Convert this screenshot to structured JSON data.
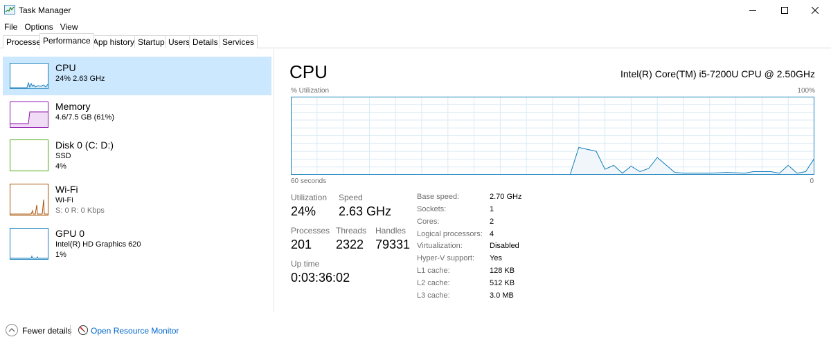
{
  "window": {
    "title": "Task Manager",
    "icon": "task-manager-icon"
  },
  "menu": [
    "File",
    "Options",
    "View"
  ],
  "tabs": [
    "Processes",
    "Performance",
    "App history",
    "Startup",
    "Users",
    "Details",
    "Services"
  ],
  "active_tab": "Performance",
  "resources": [
    {
      "name": "CPU",
      "line1": "24% 2.63 GHz",
      "line2": "",
      "color": "#117dbb",
      "selected": true
    },
    {
      "name": "Memory",
      "line1": "4.6/7.5 GB (61%)",
      "line2": "",
      "color": "#8b12ae",
      "selected": false
    },
    {
      "name": "Disk 0 (C: D:)",
      "line1": "SSD",
      "line2": "4%",
      "color": "#4da60c",
      "selected": false
    },
    {
      "name": "Wi-Fi",
      "line1": "Wi-Fi",
      "line2": "S: 0 R: 0 Kbps",
      "color": "#a74f01",
      "selected": false
    },
    {
      "name": "GPU 0",
      "line1": "Intel(R) HD Graphics 620",
      "line2": "1%",
      "color": "#117dbb",
      "selected": false
    }
  ],
  "detail": {
    "title": "CPU",
    "model": "Intel(R) Core(TM) i5-7200U CPU @ 2.50GHz",
    "util_label": "% Utilization",
    "util_max": "100%",
    "time_left": "60 seconds",
    "time_right": "0",
    "graph_color": "#117dbb",
    "stats": {
      "utilization_label": "Utilization",
      "utilization": "24%",
      "speed_label": "Speed",
      "speed": "2.63 GHz",
      "processes_label": "Processes",
      "processes": "201",
      "threads_label": "Threads",
      "threads": "2322",
      "handles_label": "Handles",
      "handles": "79331",
      "uptime_label": "Up time",
      "uptime": "0:03:36:02"
    },
    "specs": [
      {
        "label": "Base speed:",
        "value": "2.70 GHz"
      },
      {
        "label": "Sockets:",
        "value": "1"
      },
      {
        "label": "Cores:",
        "value": "2"
      },
      {
        "label": "Logical processors:",
        "value": "4"
      },
      {
        "label": "Virtualization:",
        "value": "Disabled"
      },
      {
        "label": "Hyper-V support:",
        "value": "Yes"
      },
      {
        "label": "L1 cache:",
        "value": "128 KB"
      },
      {
        "label": "L2 cache:",
        "value": "512 KB"
      },
      {
        "label": "L3 cache:",
        "value": "3.0 MB"
      }
    ]
  },
  "footer": {
    "fewer_details": "Fewer details",
    "open_monitor": "Open Resource Monitor"
  },
  "chart_data": {
    "type": "area",
    "x": [
      60,
      55,
      50,
      45,
      40,
      35,
      30,
      28,
      27,
      25,
      24,
      23,
      22,
      21,
      20,
      19,
      18,
      16,
      15,
      14,
      12,
      10,
      8,
      7,
      5,
      4,
      3,
      2,
      1,
      0
    ],
    "series": [
      {
        "values": [
          0,
          0,
          0,
          0,
          0,
          0,
          0,
          0,
          35,
          30,
          7,
          12,
          2,
          11,
          4,
          8,
          22,
          3,
          2,
          2,
          2,
          3,
          2,
          4,
          4,
          2,
          12,
          2,
          4,
          21
        ]
      }
    ],
    "ylim": [
      0,
      100
    ],
    "xlabel": "60 seconds",
    "ylabel": "% Utilization"
  }
}
